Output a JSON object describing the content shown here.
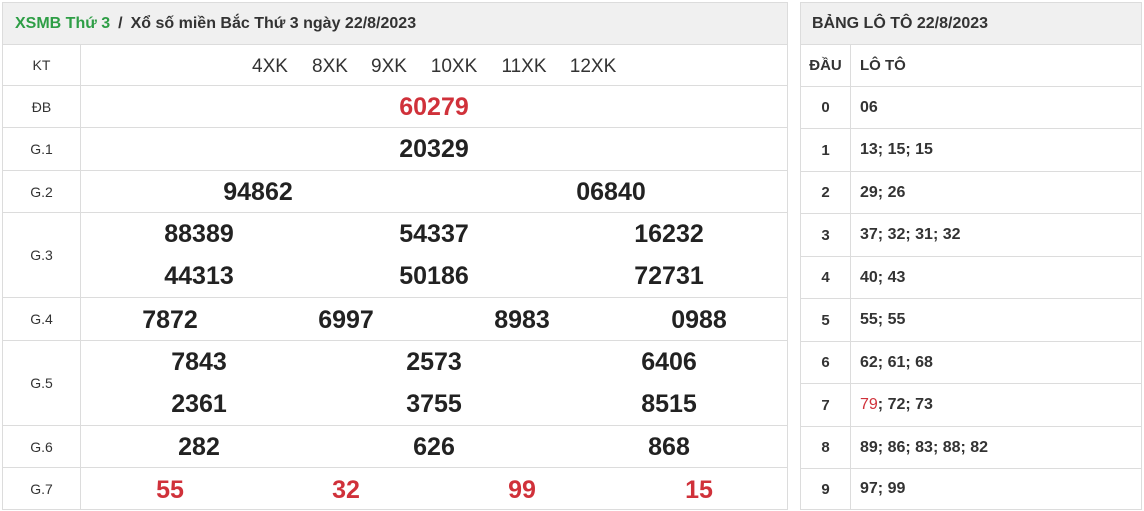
{
  "breadcrumb": {
    "home": "XSMB Thứ 3",
    "separator": "/",
    "title": "Xổ số miền Bắc Thứ 3 ngày 22/8/2023"
  },
  "results": {
    "kt_label": "KT",
    "codes": [
      "4XK",
      "8XK",
      "9XK",
      "10XK",
      "11XK",
      "12XK"
    ],
    "labels": {
      "db": "ĐB",
      "g1": "G.1",
      "g2": "G.2",
      "g3": "G.3",
      "g4": "G.4",
      "g5": "G.5",
      "g6": "G.6",
      "g7": "G.7"
    },
    "db": "60279",
    "g1": "20329",
    "g2": [
      "94862",
      "06840"
    ],
    "g3": [
      "88389",
      "54337",
      "16232",
      "44313",
      "50186",
      "72731"
    ],
    "g4": [
      "7872",
      "6997",
      "8983",
      "0988"
    ],
    "g5": [
      "7843",
      "2573",
      "6406",
      "2361",
      "3755",
      "8515"
    ],
    "g6": [
      "282",
      "626",
      "868"
    ],
    "g7": [
      "55",
      "32",
      "99",
      "15"
    ]
  },
  "loto": {
    "title": "BẢNG LÔ TÔ 22/8/2023",
    "head_label": "ĐẦU",
    "loto_label": "LÔ TÔ",
    "rows": [
      {
        "dau": "0",
        "values": "06"
      },
      {
        "dau": "1",
        "values": "13; 15; 15"
      },
      {
        "dau": "2",
        "values": "29; 26"
      },
      {
        "dau": "3",
        "values": "37; 32; 31; 32"
      },
      {
        "dau": "4",
        "values": "40; 43"
      },
      {
        "dau": "5",
        "values": "55; 55"
      },
      {
        "dau": "6",
        "values": "62; 61; 68"
      },
      {
        "dau": "7",
        "highlight": "79",
        "rest": "; 72; 73"
      },
      {
        "dau": "8",
        "values": "89; 86; 83; 88; 82"
      },
      {
        "dau": "9",
        "values": "97; 99"
      }
    ]
  },
  "colors": {
    "accent_green": "#2e9e46",
    "special_red": "#d0313a",
    "header_bg": "#f0f0f0",
    "border": "#dcdcdc"
  }
}
